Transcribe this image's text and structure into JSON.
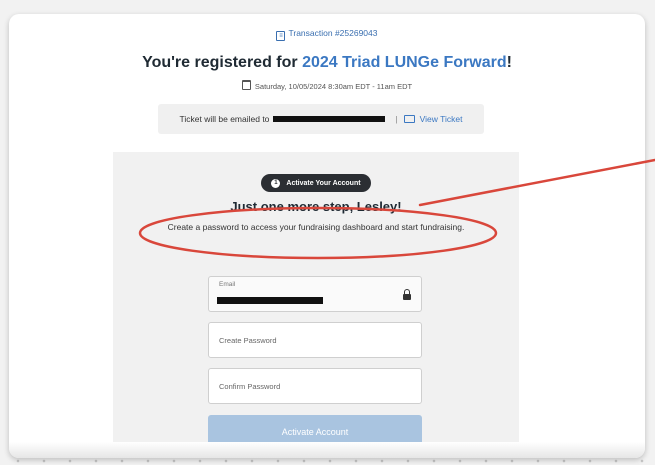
{
  "header": {
    "transaction": "Transaction #25269043",
    "title_prefix": "You're registered for ",
    "event_name": "2024 Triad LUNGe Forward",
    "title_suffix": "!",
    "datetime": "Saturday, 10/05/2024 8:30am EDT - 11am EDT"
  },
  "ticket": {
    "emailed_to_label": "Ticket will be emailed to",
    "separator": "|",
    "view_ticket_label": "View Ticket"
  },
  "activation": {
    "step_number": "1",
    "badge_label": "Activate Your Account",
    "heading": "Just one more step, Lesley!",
    "description": "Create a password to access your fundraising dashboard and start fundraising.",
    "email_label": "Email",
    "create_password_placeholder": "Create Password",
    "confirm_password_placeholder": "Confirm Password",
    "button_label": "Activate Account"
  },
  "colors": {
    "accent_blue": "#3b78c2",
    "annotation_red": "#d9473b",
    "button_disabled": "#a9c4e0",
    "badge_dark": "#2b2e33"
  },
  "icons": {
    "transaction": "receipt-icon",
    "date": "calendar-icon",
    "ticket": "ticket-icon",
    "lock": "lock-icon",
    "step": "number-circle-icon"
  }
}
